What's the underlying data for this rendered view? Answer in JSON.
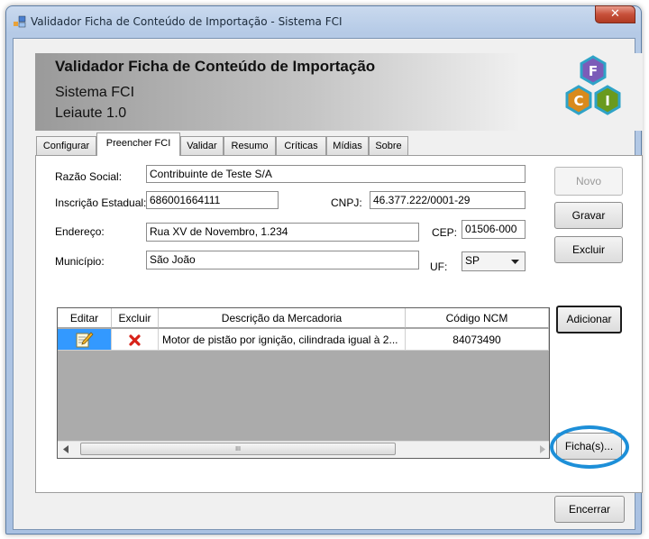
{
  "window": {
    "title": "Validador Ficha de Conteúdo de Importação - Sistema FCI",
    "close_glyph": "✕"
  },
  "header": {
    "title": "Validador Ficha de Conteúdo de Importação",
    "subtitle": "Sistema FCI",
    "version": "Leiaute 1.0",
    "logo_letters": [
      "F",
      "C",
      "I"
    ],
    "logo_colors": [
      "#7b5cb8",
      "#d98a1c",
      "#6a9a1e"
    ]
  },
  "tabs": [
    {
      "label": "Configurar",
      "active": false
    },
    {
      "label": "Preencher FCI",
      "active": true
    },
    {
      "label": "Validar",
      "active": false
    },
    {
      "label": "Resumo",
      "active": false
    },
    {
      "label": "Críticas",
      "active": false
    },
    {
      "label": "Mídias",
      "active": false
    },
    {
      "label": "Sobre",
      "active": false
    }
  ],
  "form": {
    "razao_label": "Razão Social:",
    "razao_value": "Contribuinte de Teste S/A",
    "ie_label": "Inscrição Estadual:",
    "ie_value": "686001664111",
    "cnpj_label": "CNPJ:",
    "cnpj_value": "46.377.222/0001-29",
    "endereco_label": "Endereço:",
    "endereco_value": "Rua XV de Novembro, 1.234",
    "cep_label": "CEP:",
    "cep_value": "01506-000",
    "municipio_label": "Município:",
    "municipio_value": "São João",
    "uf_label": "UF:",
    "uf_value": "SP"
  },
  "buttons": {
    "novo": "Novo",
    "gravar": "Gravar",
    "excluir": "Excluir",
    "adicionar": "Adicionar",
    "fichas": "Ficha(s)...",
    "encerrar": "Encerrar"
  },
  "grid": {
    "columns": [
      "Editar",
      "Excluir",
      "Descrição da Mercadoria",
      "Código NCM"
    ],
    "rows": [
      {
        "edit_icon": "edit-note-icon",
        "delete_icon": "red-x-delete-icon",
        "descricao": "Motor de pistão por ignição, cilindrada igual à 2...",
        "ncm": "84073490"
      }
    ],
    "scroll_thumb_mark": "III"
  }
}
